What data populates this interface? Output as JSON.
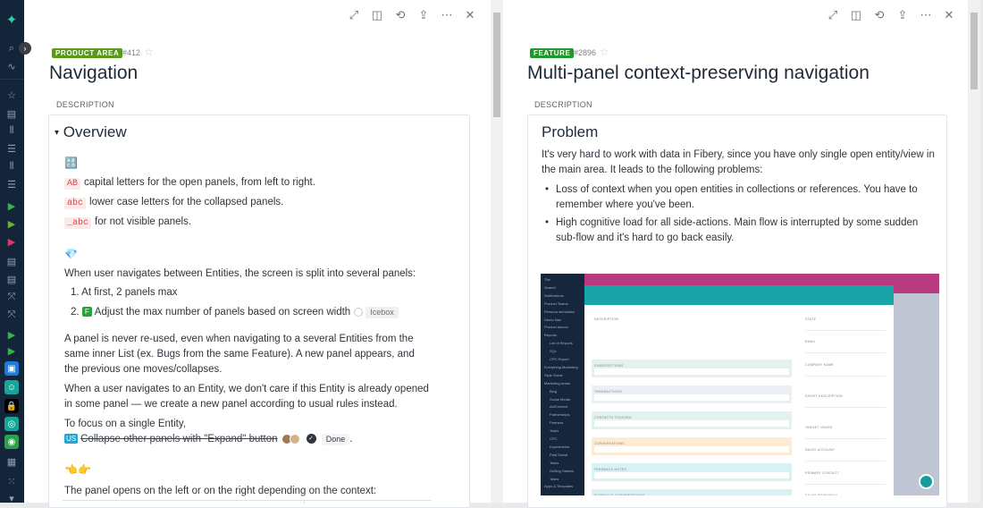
{
  "sidebar": {
    "items": [
      {
        "name": "logo",
        "glyph": "✦"
      },
      {
        "name": "search-icon",
        "glyph": "⌕"
      },
      {
        "name": "activity-icon",
        "glyph": "∿"
      },
      {
        "name": "favorites-icon",
        "glyph": "☆"
      },
      {
        "name": "doc-icon",
        "glyph": "▤"
      },
      {
        "name": "board-icon",
        "glyph": "⦀"
      },
      {
        "name": "list-icon",
        "glyph": "☰"
      },
      {
        "name": "board-icon",
        "glyph": "⦀"
      },
      {
        "name": "list-icon",
        "glyph": "☰"
      },
      {
        "name": "space-icon",
        "glyph": "▶"
      },
      {
        "name": "space-icon",
        "glyph": "▶"
      },
      {
        "name": "space-icon",
        "glyph": "▶"
      },
      {
        "name": "doc-icon",
        "glyph": "▤"
      },
      {
        "name": "doc-icon",
        "glyph": "▤"
      },
      {
        "name": "whiteboard-icon",
        "glyph": "⤧"
      },
      {
        "name": "whiteboard-icon",
        "glyph": "⤧"
      },
      {
        "name": "space-icon",
        "glyph": "▶"
      },
      {
        "name": "space-icon",
        "glyph": "▶"
      },
      {
        "name": "clipboard-app-icon",
        "glyph": "▣"
      },
      {
        "name": "smile-app-icon",
        "glyph": "☺"
      },
      {
        "name": "lock-app-icon",
        "glyph": "🔒"
      },
      {
        "name": "target-app-icon",
        "glyph": "◎"
      },
      {
        "name": "ball-app-icon",
        "glyph": "◉"
      },
      {
        "name": "templates-icon",
        "glyph": "▦"
      },
      {
        "name": "apps-icon",
        "glyph": "⁙"
      },
      {
        "name": "more-down-icon",
        "glyph": "▾"
      }
    ],
    "expand_glyph": "›"
  },
  "toolbar": {
    "expand_glyph": "⤢",
    "split_glyph": "◫",
    "history_glyph": "⟲",
    "share_glyph": "⇪",
    "more_glyph": "⋯",
    "close_glyph": "✕"
  },
  "left_panel": {
    "badge": "PRODUCT AREA",
    "badge_color": "#5a9a1a",
    "id": "#412",
    "star": "☆",
    "title": "Navigation",
    "description_label": "DESCRIPTION",
    "heading_toggle": "▾",
    "heading": "Overview",
    "emoji1": "🔠",
    "legend": [
      {
        "code": "AB",
        "text": "capital letters for the open panels, from left to right."
      },
      {
        "code": "abc",
        "text": "lower case letters for the collapsed panels."
      },
      {
        "code": "_abc",
        "text": "for not visible panels."
      }
    ],
    "emoji2": "💎",
    "split_text": "When user navigates between Entities, the screen is split into several panels:",
    "ordered": [
      {
        "num": "1.",
        "text": "At first, 2 panels max"
      },
      {
        "num": "2.",
        "tag": "F",
        "text": "Adjust the max number of panels based on screen width",
        "status": "Icebox"
      }
    ],
    "para1": "A panel is never re-used, even when navigating to a several Entities from the same inner List (ex. Bugs from the same Feature). A new panel appears, and the previous one moves/collapses.",
    "para2": "When a user navigates to an Entity, we don't care if this Entity is already opened in some panel — we create a new panel according to usual rules instead.",
    "para3": "To focus on a single Entity,",
    "story_tag": "US",
    "story_text": "Collapse other panels with \"Expand\" button",
    "story_status": "Done",
    "story_check": "✓",
    "trailing": ".",
    "emoji3": "👈👉",
    "para4": "The panel opens on the left or on the right depending on the context:"
  },
  "right_panel": {
    "badge": "FEATURE",
    "badge_color": "#1f9a2a",
    "id": "#2896",
    "star": "☆",
    "title": "Multi-panel context-preserving navigation",
    "description_label": "DESCRIPTION",
    "heading": "Problem",
    "intro": "It's very hard to work with data in Fibery, since you have only single open entity/view in the main area. It leads to the following problems:",
    "bullets": [
      "Loss of context when you open entities in collections or references. You have to remember where you've been.",
      "High cognitive load for all side-actions. Main flow is interrupted by some sudden sub-flow and it's hard to go back easily."
    ],
    "screenshot": {
      "nav_items": [
        "The",
        "Search",
        "Notifications",
        "Product Teams",
        "Persona semantics",
        "Demo Nav",
        "Product launch",
        "Reports",
        "List of Reports",
        "SQL",
        "CPC Report",
        "Everything Marketing",
        "Style Guide",
        "Marketing Areas",
        "Blog",
        "Social Media",
        "Ad/Content",
        "Partnerships",
        "Partners",
        "Tasks",
        "CPC",
        "Experiments",
        "Paid Social",
        "Tasks",
        "Getting Started",
        "Tasks",
        "Apps & Templates"
      ],
      "left_fields": [
        "DESCRIPTION",
        "SUBSCRIPTIONS",
        "TRANSACTIONS",
        "CONTACTS TOUCHED",
        "CONVERSATIONS",
        "FEEDBACK NOTES",
        "SCHEDULE CONVERSATIONS"
      ],
      "right_fields": [
        "STATE",
        "EMAIL",
        "COMPANY NAME",
        "SHORT DESCRIPTION",
        "TARGET USAGE",
        "SALES ACCOUNT",
        "PRIMARY CONTACT",
        "SALES RESEARCH"
      ],
      "section_colors": [
        "#e3f2ef",
        "#eceff3",
        "#e3f2ef",
        "#fdecd2",
        "#d8f1f3",
        "#d8f1f3"
      ]
    }
  }
}
